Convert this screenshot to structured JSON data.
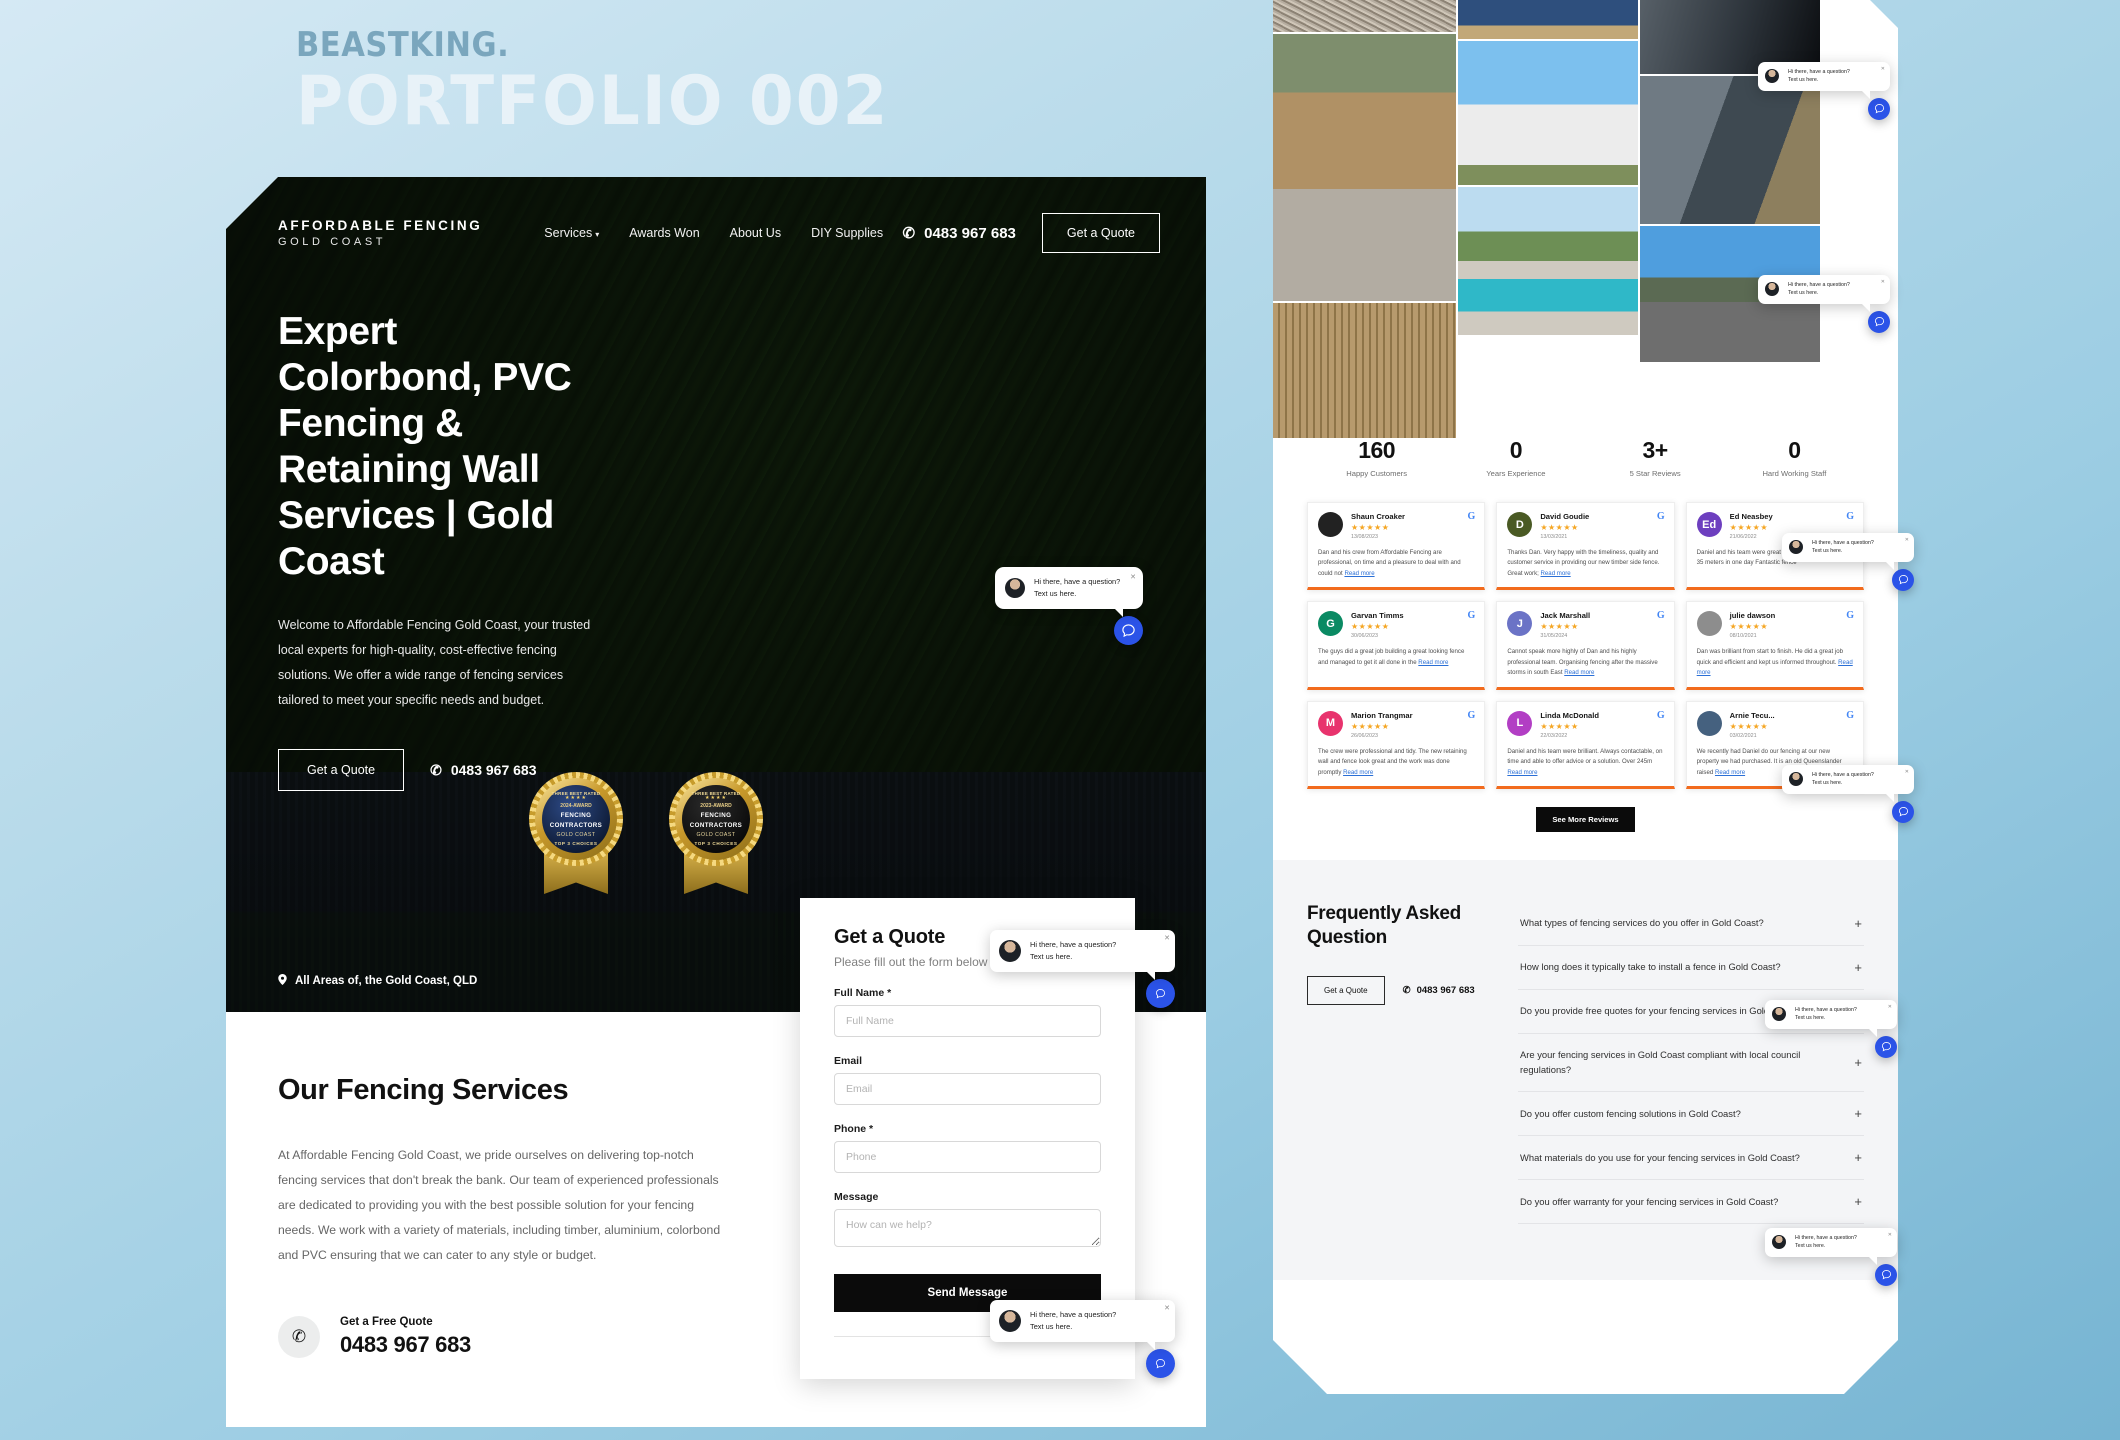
{
  "masthead": {
    "brand": "BEASTKING.",
    "title": "PORTFOLIO  002"
  },
  "site": {
    "logo_main": "AFFORDABLE FENCING",
    "logo_sub": "GOLD COAST",
    "nav": [
      {
        "label": "Services",
        "has_chevron": true
      },
      {
        "label": "Awards Won",
        "has_chevron": false
      },
      {
        "label": "About Us",
        "has_chevron": false
      },
      {
        "label": "DIY Supplies",
        "has_chevron": false
      }
    ],
    "phone": "0483 967 683",
    "nav_cta": "Get a Quote"
  },
  "hero": {
    "heading": "Expert Colorbond, PVC Fencing & Retaining Wall Services | Gold Coast",
    "paragraph": "Welcome to Affordable Fencing Gold Coast, your trusted local experts for high-quality, cost-effective fencing solutions. We offer a wide range of fencing services tailored to meet your specific needs and budget.",
    "cta": "Get a Quote",
    "phone": "0483 967 683",
    "location": "All Areas of, the Gold Coast, QLD",
    "badges": [
      {
        "top": "THREE BEST RATED",
        "stars": "★★★★",
        "year": "2024-AWARD",
        "main_line1": "FENCING",
        "main_line2": "CONTRACTORS",
        "city": "GOLD COAST",
        "bottom": "TOP 3 CHOICES"
      },
      {
        "top": "THREE BEST RATED",
        "stars": "★★★★",
        "year": "2023-AWARD",
        "main_line1": "FENCING",
        "main_line2": "CONTRACTORS",
        "city": "GOLD COAST",
        "bottom": "TOP 3 CHOICES"
      }
    ]
  },
  "services": {
    "heading": "Our Fencing Services",
    "paragraph": "At Affordable Fencing Gold Coast, we pride ourselves on delivering top-notch fencing services that don't break the bank. Our team of experienced professionals are dedicated to providing you with the best possible solution for your fencing needs. We work with a variety of materials, including timber, aluminium, colorbond and PVC ensuring that we can cater to any style or budget.",
    "quote_label": "Get a Free Quote",
    "quote_phone": "0483 967 683"
  },
  "quote_form": {
    "title": "Get a Quote",
    "subtitle": "Please fill out the form below",
    "fields": [
      {
        "label": "Full Name *",
        "placeholder": "Full Name",
        "value": "",
        "type": "input"
      },
      {
        "label": "Email",
        "placeholder": "Email",
        "value": "",
        "type": "input"
      },
      {
        "label": "Phone *",
        "placeholder": "Phone",
        "value": "",
        "type": "input"
      },
      {
        "label": "Message",
        "placeholder": "How can we help?",
        "value": "",
        "type": "textarea"
      }
    ],
    "submit": "Send Message"
  },
  "gallery": {
    "items": [
      {
        "name": "gravel-driveway-fence",
        "cls": "g-gravel"
      },
      {
        "name": "blue-colorbond-fence",
        "cls": "g-blue-fence"
      },
      {
        "name": "dark-metal-fence-closeup",
        "cls": "g-dark-metal"
      },
      {
        "name": "timber-fence-driveway",
        "cls": "g-timberyard"
      },
      {
        "name": "white-pvc-fence",
        "cls": "g-whitefence"
      },
      {
        "name": "pool-glass-fence",
        "cls": "g-pool"
      },
      {
        "name": "colorbond-side-fence",
        "cls": "g-colorbond"
      },
      {
        "name": "timber-fence-roadside",
        "cls": "g-fenceboards"
      },
      {
        "name": "carpark-fence",
        "cls": "g-carpark"
      }
    ]
  },
  "stats": [
    {
      "num": "160",
      "label": "Happy Customers"
    },
    {
      "num": "0",
      "label": "Years Experience"
    },
    {
      "num": "3+",
      "label": "5 Star Reviews"
    },
    {
      "num": "0",
      "label": "Hard Working Staff"
    }
  ],
  "reviews": {
    "items": [
      {
        "name": "Shaun Croaker",
        "stars": "★★★★★",
        "date": "13/08/2023",
        "avatar_letter": "",
        "avatar_color": "#222222",
        "text": "Dan and his crew from Affordable Fencing are professional, on time and a pleasure to deal with and could not ",
        "link": "Read more"
      },
      {
        "name": "David Goudie",
        "stars": "★★★★★",
        "date": "13/03/2021",
        "avatar_letter": "D",
        "avatar_color": "#4a5a24",
        "text": "Thanks Dan. Very happy with the timeliness, quality and customer service in providing our new timber side fence. Great work; ",
        "link": "Read more"
      },
      {
        "name": "Ed Neasbey",
        "stars": "★★★★★",
        "date": "21/06/2022",
        "avatar_letter": "Ed",
        "avatar_color": "#6d3fbf",
        "text": "Daniel and his team were great Never stopped working 35 meters in one day Fantastic fence",
        "link": ""
      },
      {
        "name": "Garvan Timms",
        "stars": "★★★★★",
        "date": "30/06/2023",
        "avatar_letter": "G",
        "avatar_color": "#0a8a63",
        "text": "The guys did a great job building a great looking fence and managed to get it all done in the ",
        "link": "Read more"
      },
      {
        "name": "Jack Marshall",
        "stars": "★★★★★",
        "date": "31/05/2024",
        "avatar_letter": "J",
        "avatar_color": "#6b73c6",
        "text": "Cannot speak more highly of Dan and his highly professional team. Organising fencing after the massive storms in south East ",
        "link": "Read more"
      },
      {
        "name": "julie dawson",
        "stars": "★★★★★",
        "date": "08/10/2021",
        "avatar_letter": "",
        "avatar_color": "#8d8d8d",
        "text": "Dan was brilliant from start to finish. He did a great job quick and efficient and kept us informed throughout. ",
        "link": "Read more"
      },
      {
        "name": "Marion Trangmar",
        "stars": "★★★★★",
        "date": "26/06/2023",
        "avatar_letter": "M",
        "avatar_color": "#e8336d",
        "text": "The crew were professional and tidy. The new retaining wall and fence look great and the work was done promptly ",
        "link": "Read more"
      },
      {
        "name": "Linda McDonald",
        "stars": "★★★★★",
        "date": "22/03/2022",
        "avatar_letter": "L",
        "avatar_color": "#b23ec4",
        "text": "Daniel and his team were brilliant. Always contactable, on time and able to offer advice or a solution. Over 245m ",
        "link": "Read more"
      },
      {
        "name": "Arnie Tecu...",
        "stars": "★★★★★",
        "date": "03/02/2021",
        "avatar_letter": "",
        "avatar_color": "#45617f",
        "text": "We recently had Daniel do our fencing at our new property we had purchased. It is an old Queenslander raised ",
        "link": "Read more"
      }
    ],
    "see_more": "See More Reviews",
    "google_mark": "G"
  },
  "faq": {
    "heading": "Frequently Asked Question",
    "cta": "Get a Quote",
    "phone": "0483 967 683",
    "items": [
      "What types of fencing services do you offer in Gold Coast?",
      "How long does it typically take to install a fence in Gold Coast?",
      "Do you provide free quotes for your fencing services in Gold Coast?",
      "Are your fencing services in Gold Coast compliant with local council regulations?",
      "Do you offer custom fencing solutions in Gold Coast?",
      "What materials do you use for your fencing services in Gold Coast?",
      "Do you offer warranty for your fencing services in Gold Coast?"
    ],
    "plus": "+"
  },
  "chat": {
    "line1": "Hi there, have a question?",
    "line2": "Text us here.",
    "close": "✕"
  },
  "icons": {
    "phone": "✆",
    "pin": "📍",
    "chevron": "▾"
  }
}
